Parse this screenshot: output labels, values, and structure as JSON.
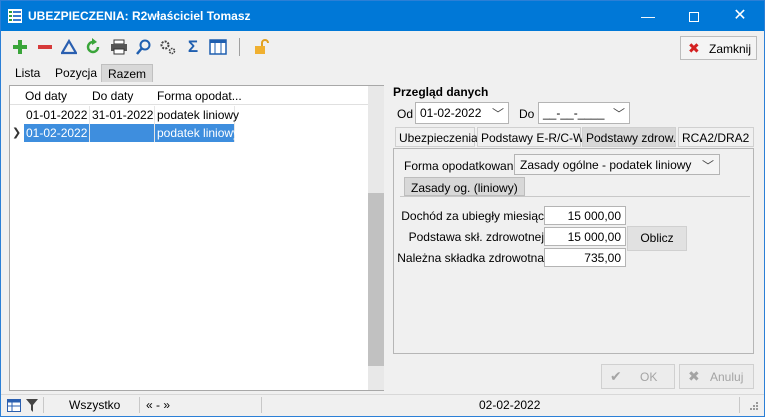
{
  "window": {
    "title": "UBEZPIECZENIA: R2właściciel Tomasz",
    "minimize_glyph": "—",
    "close_glyph": "✕"
  },
  "toolbar": {
    "icons": [
      "plus-icon",
      "minus-icon",
      "filter-icon",
      "refresh-icon",
      "print-icon",
      "search-icon",
      "settings-icon",
      "sum-icon",
      "columns-icon",
      "lock-icon"
    ],
    "close_label": "Zamknij"
  },
  "tabs_left": [
    {
      "label": "Lista",
      "active": false
    },
    {
      "label": "Pozycja",
      "active": false
    },
    {
      "label": "Razem",
      "active": true
    }
  ],
  "grid": {
    "columns": [
      "Od daty",
      "Do daty",
      "Forma opodat..."
    ],
    "rows": [
      {
        "od": "01-01-2022",
        "do": "31-01-2022",
        "forma": "podatek liniowy",
        "selected": false
      },
      {
        "od": "01-02-2022",
        "do": "",
        "forma": "podatek liniowy",
        "selected": true
      }
    ]
  },
  "przeglad": {
    "title": "Przegląd danych",
    "od_label": "Od",
    "od_value": "01-02-2022",
    "do_label": "Do",
    "do_value": "__-__-____"
  },
  "right_tabs": [
    {
      "label": "Ubezpieczenia",
      "active": false
    },
    {
      "label": "Podstawy E-R/C-W",
      "active": false
    },
    {
      "label": "Podstawy zdrow.",
      "active": true
    },
    {
      "label": "RCA2/DRA2",
      "active": false
    }
  ],
  "zdrow": {
    "forma_label": "Forma opodatkowania",
    "forma_value": "Zasady ogólne - podatek liniowy",
    "subtab": "Zasady og. (liniowy)",
    "fields": [
      {
        "label": "Dochód za ubiegły miesiąc",
        "value": "15 000,00"
      },
      {
        "label": "Podstawa skł. zdrowotnej",
        "value": "15 000,00"
      },
      {
        "label": "Należna składka zdrowotna",
        "value": "735,00"
      }
    ],
    "oblicz_label": "Oblicz"
  },
  "buttons": {
    "ok_label": "OK",
    "anuluj_label": "Anuluj"
  },
  "status": {
    "filter_label": "Wszystko",
    "range_label": "« - »",
    "date": "02-02-2022"
  }
}
